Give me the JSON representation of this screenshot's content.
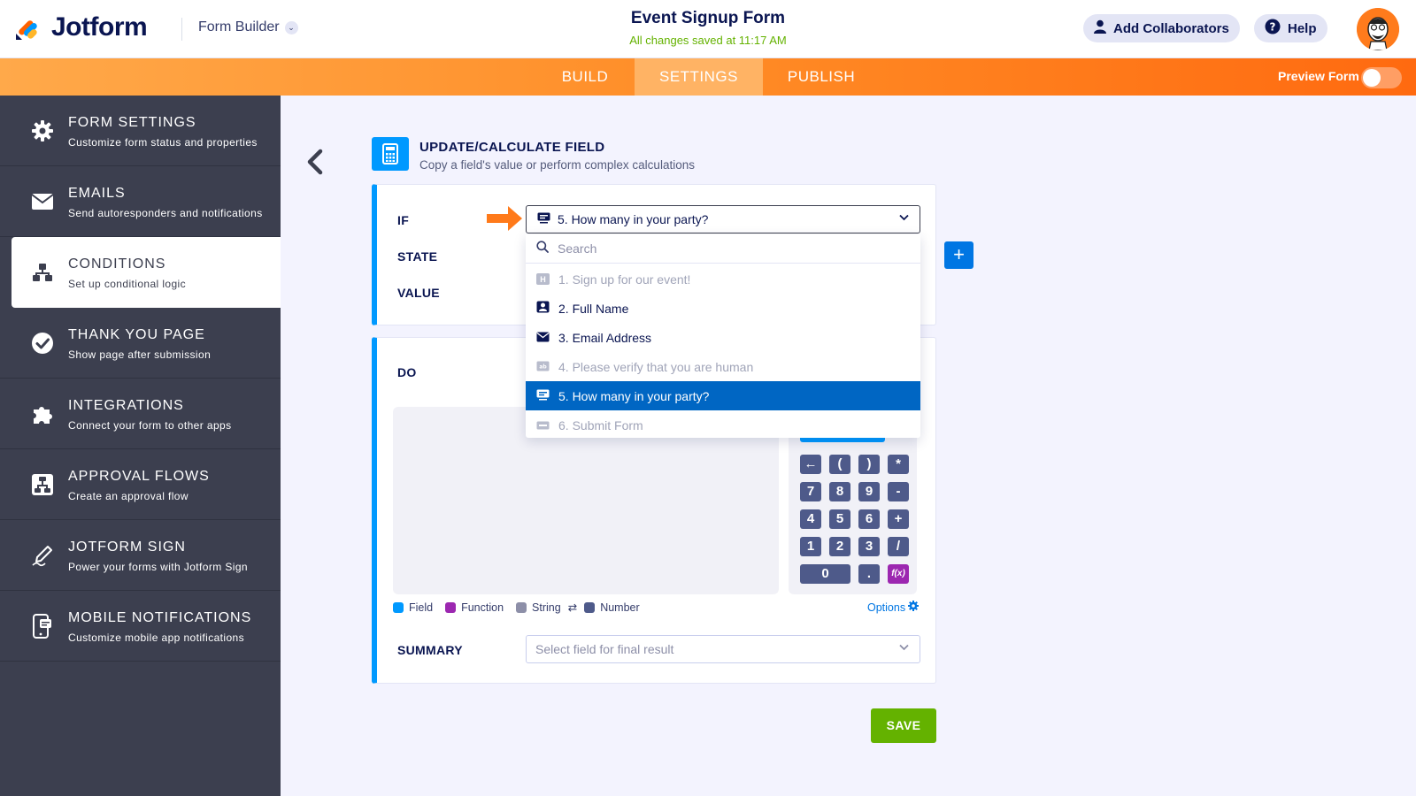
{
  "header": {
    "logo_text": "Jotform",
    "builder_label": "Form Builder",
    "form_title": "Event Signup Form",
    "saved_status": "All changes saved at 11:17 AM",
    "add_collaborators_label": "Add Collaborators",
    "help_label": "Help"
  },
  "nav": {
    "tabs": [
      {
        "label": "BUILD",
        "active": false
      },
      {
        "label": "SETTINGS",
        "active": true
      },
      {
        "label": "PUBLISH",
        "active": false
      }
    ],
    "preview_label": "Preview Form",
    "preview_on": false
  },
  "sidebar": {
    "items": [
      {
        "title": "FORM SETTINGS",
        "subtitle": "Customize form status and properties",
        "icon": "gear-icon"
      },
      {
        "title": "EMAILS",
        "subtitle": "Send autoresponders and notifications",
        "icon": "envelope-icon"
      },
      {
        "title": "CONDITIONS",
        "subtitle": "Set up conditional logic",
        "icon": "hierarchy-icon",
        "active": true
      },
      {
        "title": "THANK YOU PAGE",
        "subtitle": "Show page after submission",
        "icon": "check-circle-icon"
      },
      {
        "title": "INTEGRATIONS",
        "subtitle": "Connect your form to other apps",
        "icon": "puzzle-icon"
      },
      {
        "title": "APPROVAL FLOWS",
        "subtitle": "Create an approval flow",
        "icon": "flow-icon"
      },
      {
        "title": "JOTFORM SIGN",
        "subtitle": "Power your forms with Jotform Sign",
        "icon": "pen-icon"
      },
      {
        "title": "MOBILE NOTIFICATIONS",
        "subtitle": "Customize mobile app notifications",
        "icon": "mobile-icon"
      }
    ]
  },
  "main": {
    "heading": "UPDATE/CALCULATE FIELD",
    "subheading": "Copy a field's value or perform complex calculations",
    "if_label": "IF",
    "state_label": "STATE",
    "value_label": "VALUE",
    "do_label": "DO",
    "summary_label": "SUMMARY",
    "if_selected": "5. How many in your party?",
    "summary_placeholder": "Select field for final result",
    "save_label": "SAVE",
    "plus_label": "+"
  },
  "dropdown": {
    "search_placeholder": "Search",
    "items": [
      {
        "label": "1. Sign up for our event!",
        "disabled": true,
        "icon": "heading-icon"
      },
      {
        "label": "2. Full Name",
        "disabled": false,
        "icon": "person-icon"
      },
      {
        "label": "3. Email Address",
        "disabled": false,
        "icon": "envelope-icon"
      },
      {
        "label": "4. Please verify that you are human",
        "disabled": true,
        "icon": "captcha-icon"
      },
      {
        "label": "5. How many in your party?",
        "disabled": false,
        "selected": true,
        "icon": "number-icon"
      },
      {
        "label": "6. Submit Form",
        "disabled": true,
        "icon": "submit-icon"
      }
    ]
  },
  "keypad": {
    "keys": [
      "←",
      "(",
      ")",
      "*",
      "7",
      "8",
      "9",
      "-",
      "4",
      "5",
      "6",
      "+",
      "1",
      "2",
      "3",
      "/",
      "0",
      ".",
      "f(x)"
    ]
  },
  "legend": {
    "field": "Field",
    "function": "Function",
    "string": "String",
    "swap": "⇄",
    "number": "Number",
    "options": "Options"
  },
  "colors": {
    "accent_blue": "#0099ff",
    "selected_blue": "#0066c3",
    "orange": "#ff8c26",
    "green": "#64b200",
    "sidebar": "#3c3f4f",
    "function_purple": "#9c27b0"
  }
}
